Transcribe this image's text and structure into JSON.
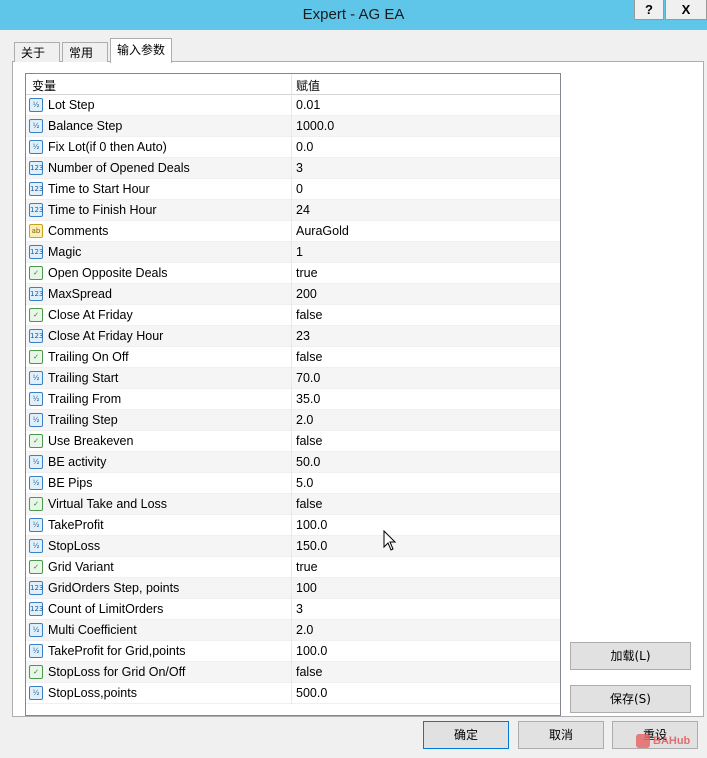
{
  "window": {
    "title": "Expert - AG EA",
    "help_label": "?",
    "close_label": "X"
  },
  "tabs": [
    {
      "label": "关于",
      "active": false
    },
    {
      "label": "常用",
      "active": false
    },
    {
      "label": "输入参数",
      "active": true
    }
  ],
  "grid": {
    "col_variable": "变量",
    "col_value": "赋值",
    "rows": [
      {
        "type": "double",
        "icon": "double-type-icon",
        "name": "Lot Step",
        "value": "0.01"
      },
      {
        "type": "double",
        "icon": "double-type-icon",
        "name": "Balance Step",
        "value": "1000.0"
      },
      {
        "type": "double",
        "icon": "double-type-icon",
        "name": "Fix Lot(if 0 then Auto)",
        "value": "0.0"
      },
      {
        "type": "int",
        "icon": "integer-type-icon",
        "name": "Number of Opened Deals",
        "value": "3"
      },
      {
        "type": "int",
        "icon": "integer-type-icon",
        "name": "Time to Start Hour",
        "value": "0"
      },
      {
        "type": "int",
        "icon": "integer-type-icon",
        "name": "Time to Finish Hour",
        "value": "24"
      },
      {
        "type": "string",
        "icon": "string-type-icon",
        "name": "Comments",
        "value": "AuraGold"
      },
      {
        "type": "int",
        "icon": "integer-type-icon",
        "name": "Magic",
        "value": "1"
      },
      {
        "type": "bool",
        "icon": "boolean-type-icon",
        "name": "Open Opposite Deals",
        "value": "true"
      },
      {
        "type": "int",
        "icon": "integer-type-icon",
        "name": "MaxSpread",
        "value": "200"
      },
      {
        "type": "bool",
        "icon": "boolean-type-icon",
        "name": "Close At Friday",
        "value": "false"
      },
      {
        "type": "int",
        "icon": "integer-type-icon",
        "name": "Close At Friday Hour",
        "value": "23"
      },
      {
        "type": "bool",
        "icon": "boolean-type-icon",
        "name": "Trailing On Off",
        "value": "false"
      },
      {
        "type": "double",
        "icon": "double-type-icon",
        "name": "Trailing Start",
        "value": "70.0"
      },
      {
        "type": "double",
        "icon": "double-type-icon",
        "name": "Trailing From",
        "value": "35.0"
      },
      {
        "type": "double",
        "icon": "double-type-icon",
        "name": "Trailing Step",
        "value": "2.0"
      },
      {
        "type": "bool",
        "icon": "boolean-type-icon",
        "name": "Use Breakeven",
        "value": "false"
      },
      {
        "type": "double",
        "icon": "double-type-icon",
        "name": "BE activity",
        "value": "50.0"
      },
      {
        "type": "double",
        "icon": "double-type-icon",
        "name": "BE Pips",
        "value": "5.0"
      },
      {
        "type": "bool",
        "icon": "boolean-type-icon",
        "name": "Virtual Take and Loss",
        "value": "false"
      },
      {
        "type": "double",
        "icon": "double-type-icon",
        "name": "TakeProfit",
        "value": "100.0"
      },
      {
        "type": "double",
        "icon": "double-type-icon",
        "name": "StopLoss",
        "value": "150.0"
      },
      {
        "type": "bool",
        "icon": "boolean-type-icon",
        "name": "Grid Variant",
        "value": "true"
      },
      {
        "type": "int",
        "icon": "integer-type-icon",
        "name": "GridOrders Step, points",
        "value": "100"
      },
      {
        "type": "int",
        "icon": "integer-type-icon",
        "name": "Count of LimitOrders",
        "value": "3"
      },
      {
        "type": "double",
        "icon": "double-type-icon",
        "name": "Multi Coefficient",
        "value": "2.0"
      },
      {
        "type": "double",
        "icon": "double-type-icon",
        "name": "TakeProfit for Grid,points",
        "value": "100.0"
      },
      {
        "type": "bool",
        "icon": "boolean-type-icon",
        "name": "StopLoss for Grid On/Off",
        "value": "false"
      },
      {
        "type": "double",
        "icon": "double-type-icon",
        "name": "StopLoss,points",
        "value": "500.0"
      }
    ]
  },
  "buttons": {
    "load": "加载(L)",
    "save": "保存(S)",
    "ok": "确定",
    "cancel": "取消",
    "reset": "重设"
  },
  "watermark": "BAHub",
  "colors": {
    "titlebar": "#5fc6ea",
    "default_button_border": "#0078d7"
  }
}
